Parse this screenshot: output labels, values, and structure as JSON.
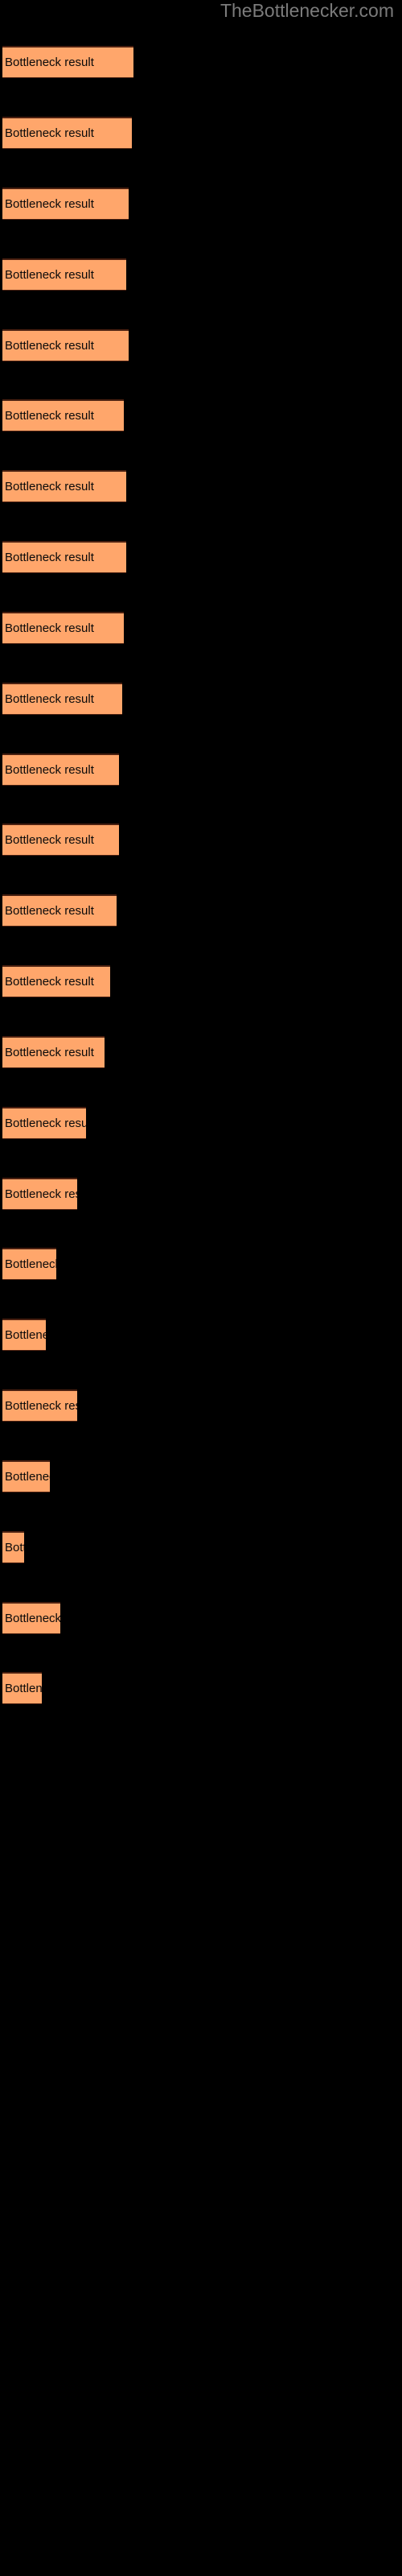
{
  "header": {
    "site_title": "TheBottlenecker.com"
  },
  "colors": {
    "background": "#000000",
    "bar_fill": "#ffa66b",
    "bar_edge": "#4a2010",
    "label_text": "#0a0a0a",
    "title_text": "#7b7b7b"
  },
  "chart_data": {
    "type": "bar",
    "orientation": "horizontal",
    "title": "TheBottlenecker.com",
    "xlabel": "",
    "ylabel": "",
    "grid": false,
    "legend": null,
    "axis_visible": false,
    "tick_labels": [],
    "bar_label_text": "Bottleneck result",
    "categories": [
      "Bottleneck result",
      "Bottleneck result",
      "Bottleneck result",
      "Bottleneck result",
      "Bottleneck result",
      "Bottleneck result",
      "Bottleneck result",
      "Bottleneck result",
      "Bottleneck result",
      "Bottleneck result",
      "Bottleneck result",
      "Bottleneck result",
      "Bottleneck result",
      "Bottleneck result",
      "Bottleneck result",
      "Bottleneck result",
      "Bottleneck result",
      "Bottleneck result",
      "Bottleneck result",
      "Bottleneck result",
      "Bottleneck result",
      "Bottleneck result",
      "Bottleneck result",
      "Bottleneck result"
    ],
    "values": [
      163,
      161,
      157,
      154,
      157,
      151,
      154,
      154,
      151,
      149,
      145,
      145,
      142,
      134,
      127,
      104,
      93,
      67,
      54,
      93,
      59,
      27,
      72,
      49
    ],
    "xlim": [
      0,
      500
    ],
    "bars": [
      {
        "index": 1,
        "label": "Bottleneck result",
        "width": 163,
        "top": 57
      },
      {
        "index": 2,
        "label": "Bottleneck result",
        "width": 161,
        "top": 145
      },
      {
        "index": 3,
        "label": "Bottleneck result",
        "width": 157,
        "top": 233
      },
      {
        "index": 4,
        "label": "Bottleneck result",
        "width": 154,
        "top": 321
      },
      {
        "index": 5,
        "label": "Bottleneck result",
        "width": 157,
        "top": 409
      },
      {
        "index": 6,
        "label": "Bottleneck result",
        "width": 151,
        "top": 496
      },
      {
        "index": 7,
        "label": "Bottleneck result",
        "width": 154,
        "top": 584
      },
      {
        "index": 8,
        "label": "Bottleneck result",
        "width": 154,
        "top": 672
      },
      {
        "index": 9,
        "label": "Bottleneck result",
        "width": 151,
        "top": 760
      },
      {
        "index": 10,
        "label": "Bottleneck result",
        "width": 149,
        "top": 848
      },
      {
        "index": 11,
        "label": "Bottleneck result",
        "width": 145,
        "top": 936
      },
      {
        "index": 12,
        "label": "Bottleneck result",
        "width": 145,
        "top": 1023
      },
      {
        "index": 13,
        "label": "Bottleneck result",
        "width": 142,
        "top": 1111
      },
      {
        "index": 14,
        "label": "Bottleneck result",
        "width": 134,
        "top": 1199
      },
      {
        "index": 15,
        "label": "Bottleneck result",
        "width": 127,
        "top": 1287
      },
      {
        "index": 16,
        "label": "Bottleneck result",
        "width": 104,
        "top": 1375
      },
      {
        "index": 17,
        "label": "Bottleneck result",
        "width": 93,
        "top": 1463
      },
      {
        "index": 18,
        "label": "Bottleneck result",
        "width": 67,
        "top": 1550
      },
      {
        "index": 19,
        "label": "Bottleneck result",
        "width": 54,
        "top": 1638
      },
      {
        "index": 20,
        "label": "Bottleneck result",
        "width": 93,
        "top": 1726
      },
      {
        "index": 21,
        "label": "Bottleneck result",
        "width": 59,
        "top": 1814
      },
      {
        "index": 22,
        "label": "Bottleneck result",
        "width": 27,
        "top": 1902
      },
      {
        "index": 23,
        "label": "Bottleneck result",
        "width": 72,
        "top": 1990
      },
      {
        "index": 24,
        "label": "Bottleneck result",
        "width": 49,
        "top": 2077
      }
    ]
  }
}
